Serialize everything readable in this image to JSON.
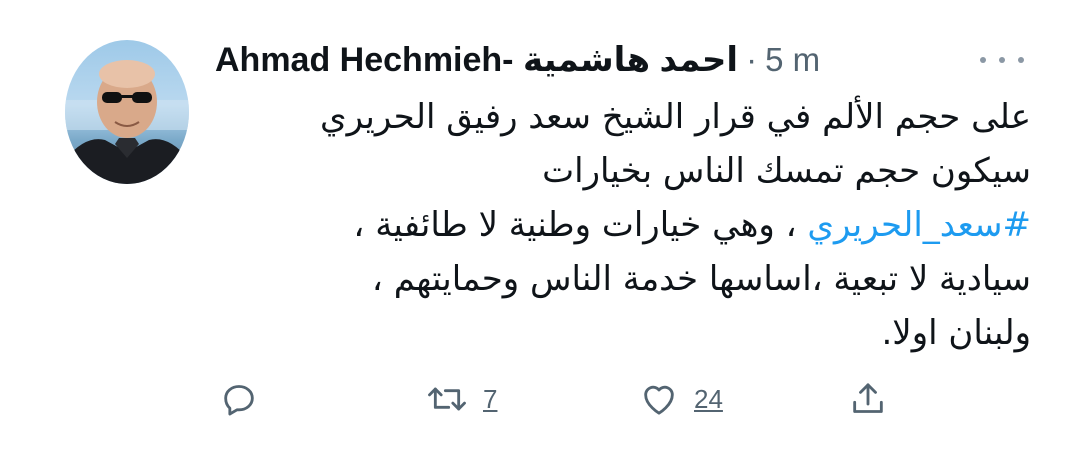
{
  "tweet": {
    "author_name": "Ahmad Hechmieh- احمد هاشمية",
    "separator": "·",
    "time": "5 m",
    "lines": [
      "على حجم  الألم في قرار الشيخ سعد رفيق الحريري",
      "سيكون حجم تمسك الناس بخيارات",
      "، وهي خيارات وطنية لا طائفية ،",
      "سيادية لا تبعية ،اساسها  خدمة الناس وحمايتهم ،",
      "ولبنان اولا."
    ],
    "hashtag": "#سعد_الحريري",
    "accent_color": "#1d9bf0"
  },
  "actions": {
    "reply_icon": "reply-icon",
    "retweet_icon": "retweet-icon",
    "retweet_count": "7",
    "like_icon": "heart-icon",
    "like_count": "24",
    "share_icon": "share-icon"
  }
}
